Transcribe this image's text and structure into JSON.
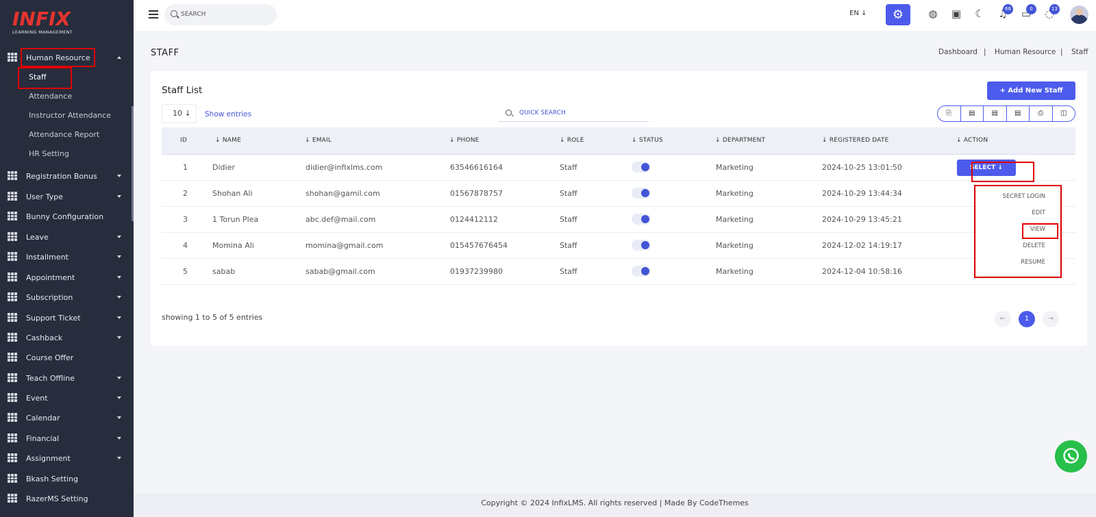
{
  "brand": {
    "logo_word": "INFIX",
    "logo_sub": "LEARNING MANAGEMENT"
  },
  "sidebar": {
    "menu": [
      {
        "label": "Human Resource",
        "expanded": true
      },
      {
        "label": "Registration Bonus"
      },
      {
        "label": "User Type"
      },
      {
        "label": "Bunny Configuration"
      },
      {
        "label": "Leave"
      },
      {
        "label": "Installment"
      },
      {
        "label": "Appointment"
      },
      {
        "label": "Subscription"
      },
      {
        "label": "Support Ticket"
      },
      {
        "label": "Cashback"
      },
      {
        "label": "Course Offer"
      },
      {
        "label": "Teach Offline"
      },
      {
        "label": "Event"
      },
      {
        "label": "Calendar"
      },
      {
        "label": "Financial"
      },
      {
        "label": "Assignment"
      },
      {
        "label": "Bkash Setting"
      },
      {
        "label": "RazerMS Setting"
      }
    ],
    "hr_sub": [
      "Staff",
      "Attendance",
      "Instructor Attendance",
      "Attendance Report",
      "HR Setting"
    ]
  },
  "topbar": {
    "search_placeholder": "SEARCH",
    "lang": "EN",
    "badges": {
      "notifications": "68",
      "messages": "0",
      "whatsapp": "13"
    },
    "icons": [
      "hamburger-icon",
      "search-icon",
      "gear-icon",
      "globe-icon",
      "layout-icon",
      "moon-icon",
      "bell-icon",
      "chat-icon",
      "whatsapp-icon"
    ]
  },
  "page": {
    "title": "STAFF",
    "breadcrumb": [
      "Dashboard",
      "Human Resource",
      "Staff"
    ],
    "sep": "|"
  },
  "card": {
    "title": "Staff List",
    "add_button": "Add New Staff",
    "entries_value": "10",
    "show_entries": "Show entries",
    "quick_search_placeholder": "QUICK SEARCH"
  },
  "table": {
    "headers": [
      "ID",
      "NAME",
      "EMAIL",
      "PHONE",
      "ROLE",
      "STATUS",
      "DEPARTMENT",
      "REGISTERED DATE",
      "ACTION"
    ],
    "rows": [
      {
        "id": "1",
        "name": "Didier",
        "email": "didier@infixlms.com",
        "phone": "63546616164",
        "role": "Staff",
        "status": true,
        "department": "Marketing",
        "date": "2024-10-25 13:01:50"
      },
      {
        "id": "2",
        "name": "Shohan Ali",
        "email": "shohan@gamil.com",
        "phone": "01567878757",
        "role": "Staff",
        "status": true,
        "department": "Marketing",
        "date": "2024-10-29 13:44:34"
      },
      {
        "id": "3",
        "name": "1 Torun Plea",
        "email": "abc.def@mail.com",
        "phone": "0124412112",
        "role": "Staff",
        "status": true,
        "department": "Marketing",
        "date": "2024-10-29 13:45:21"
      },
      {
        "id": "4",
        "name": "Momina Ali",
        "email": "momina@gmail.com",
        "phone": "015457676454",
        "role": "Staff",
        "status": true,
        "department": "Marketing",
        "date": "2024-12-02 14:19:17"
      },
      {
        "id": "5",
        "name": "sabab",
        "email": "sabab@gmail.com",
        "phone": "01937239980",
        "role": "Staff",
        "status": true,
        "department": "Marketing",
        "date": "2024-12-04 10:58:16"
      }
    ],
    "select_label": "SELECT",
    "dropdown": [
      "SECRET LOGIN",
      "EDIT",
      "VIEW",
      "DELETE",
      "RESUME"
    ],
    "showing": "showing 1 to 5 of 5 entries",
    "current_page": "1"
  },
  "footer": {
    "text": "Copyright © 2024 InfixLMS. All rights reserved | Made By CodeThemes"
  },
  "colors": {
    "sidebar": "#272d3d",
    "accent": "#4d5bec",
    "highlight": "#e00000",
    "whatsapp": "#27c04a"
  }
}
